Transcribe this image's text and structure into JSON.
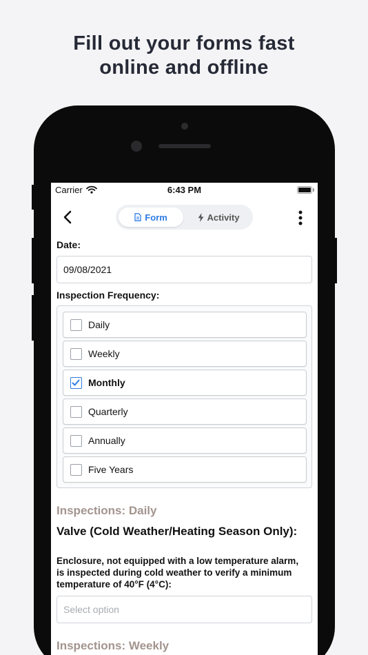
{
  "marketing": {
    "headline_line1": "Fill out your forms fast",
    "headline_line2": "online and offline"
  },
  "status_bar": {
    "carrier": "Carrier",
    "time": "6:43 PM"
  },
  "nav": {
    "tabs": [
      {
        "label": "Form",
        "icon": "document-icon",
        "active": true
      },
      {
        "label": "Activity",
        "icon": "lightning-icon",
        "active": false
      }
    ]
  },
  "form": {
    "date_label": "Date:",
    "date_value": "09/08/2021",
    "frequency_label": "Inspection Frequency:",
    "frequency_options": [
      {
        "label": "Daily",
        "checked": false
      },
      {
        "label": "Weekly",
        "checked": false
      },
      {
        "label": "Monthly",
        "checked": true
      },
      {
        "label": "Quarterly",
        "checked": false
      },
      {
        "label": "Annually",
        "checked": false
      },
      {
        "label": "Five Years",
        "checked": false
      }
    ],
    "section_daily": "Inspections: Daily",
    "question_group": "Valve (Cold Weather/Heating Season Only):",
    "question_text": "Enclosure, not equipped with a low temperature alarm, is inspected during cold weather to verify a minimum temperature of 40°F (4°C):",
    "select_placeholder": "Select option",
    "section_weekly": "Inspections: Weekly"
  },
  "colors": {
    "accent": "#2e7be4",
    "section_title": "#a3948e",
    "headline": "#262a36"
  }
}
